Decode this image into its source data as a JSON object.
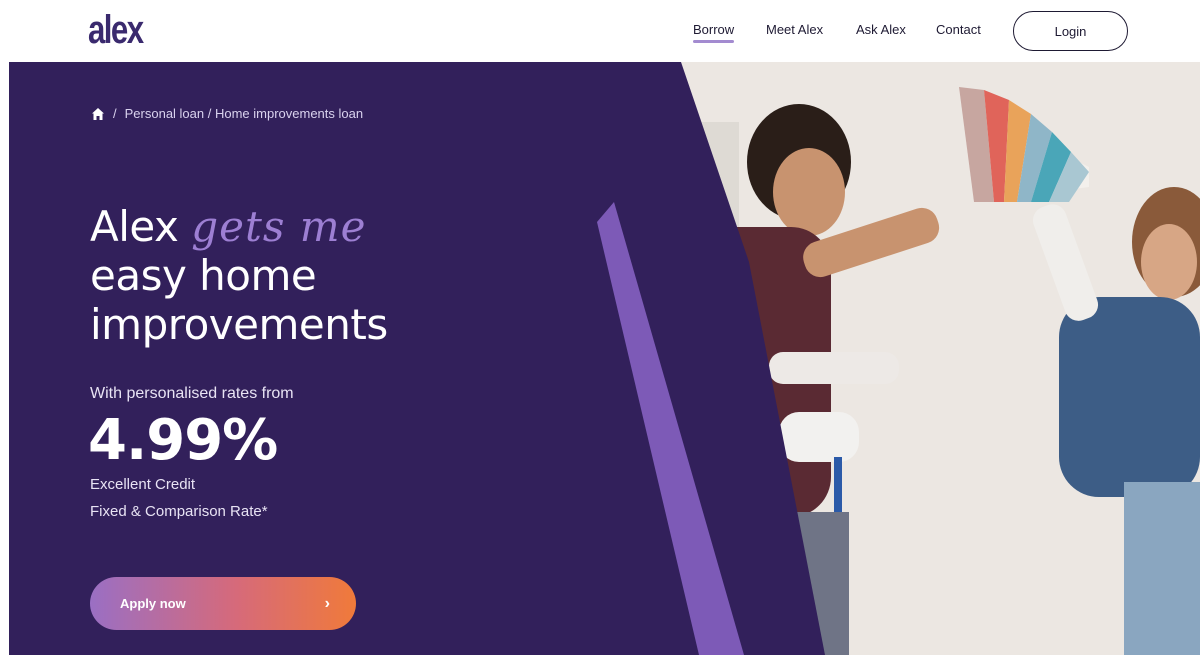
{
  "header": {
    "logo": "alex",
    "nav": [
      {
        "label": "Borrow",
        "active": true
      },
      {
        "label": "Meet Alex",
        "active": false
      },
      {
        "label": "Ask Alex",
        "active": false
      },
      {
        "label": "Contact",
        "active": false
      }
    ],
    "login_label": "Login"
  },
  "hero": {
    "breadcrumb": {
      "home_icon": "home-icon",
      "separator": "/",
      "path": "Personal loan / Home improvements loan"
    },
    "headline": {
      "line1_plain": "Alex",
      "line1_accent": "gets me",
      "line2": "easy home",
      "line3": "improvements"
    },
    "subline": "With personalised rates from",
    "rate": "4.99%",
    "rate_note_1": "Excellent Credit",
    "rate_note_2": "Fixed & Comparison Rate*",
    "cta_label": "Apply now",
    "cta_icon": "chevron-right-icon"
  },
  "colors": {
    "brand_purple": "#34205a",
    "accent_lavender": "#9d7fd3",
    "cta_gradient_start": "#9a6fc4",
    "cta_gradient_end": "#f07a3a"
  }
}
